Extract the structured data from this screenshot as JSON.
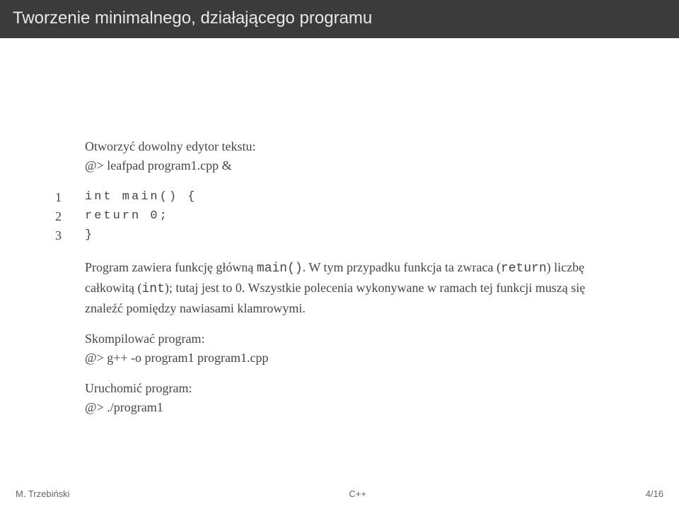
{
  "title": "Tworzenie minimalnego, działającego programu",
  "intro": {
    "text": "Otworzyć dowolny edytor tekstu:",
    "cmd": "@> leafpad program1.cpp &"
  },
  "code": {
    "l1": {
      "n": "1",
      "text": "int main() {"
    },
    "l2": {
      "n": "2",
      "text": "  return 0;"
    },
    "l3": {
      "n": "3",
      "text": "}"
    }
  },
  "para1": {
    "a": "Program zawiera funkcję główną ",
    "b": "main()",
    "c": ". W tym przypadku funkcja ta zwraca (",
    "d": "return",
    "e": ") liczbę całkowitą (",
    "f": "int",
    "g": "); tutaj jest to 0. Wszystkie polecenia wykonywane w ramach tej funkcji muszą się znaleźć pomiędzy nawiasami klamrowymi."
  },
  "compile": {
    "label": "Skompilować program:",
    "cmd": "@> g++ -o program1 program1.cpp"
  },
  "run": {
    "label": "Uruchomić program:",
    "cmd": "@> ./program1"
  },
  "footer": {
    "left": "M. Trzebiński",
    "center": "C++",
    "right": "4/16"
  }
}
